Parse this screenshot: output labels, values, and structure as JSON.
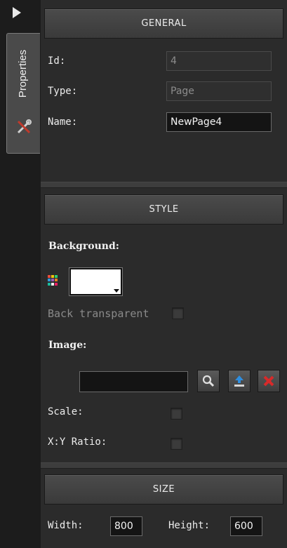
{
  "sidebar": {
    "tab_label": "Properties",
    "collapse_icon": "triangle-right-icon",
    "tab_icon": "tools-icon"
  },
  "general": {
    "header": "GENERAL",
    "id_label": "Id:",
    "id_value": "4",
    "type_label": "Type:",
    "type_value": "Page",
    "name_label": "Name:",
    "name_value": "NewPage4"
  },
  "style": {
    "header": "STYLE",
    "background_label": "Background:",
    "background_color": "#ffffff",
    "back_transparent_label": "Back transparent",
    "image_label": "Image:",
    "image_value": "",
    "scale_label": "Scale:",
    "ratio_label": "X:Y Ratio:"
  },
  "size": {
    "header": "SIZE",
    "width_label": "Width:",
    "width_value": "800",
    "height_label": "Height:",
    "height_value": "600"
  },
  "colors": {
    "panel_bg": "#2b2b2b",
    "header_bg": "#444444",
    "search_icon": "#dddddd",
    "upload_icon": "#2e8ee0",
    "delete_icon": "#d82a2a"
  }
}
